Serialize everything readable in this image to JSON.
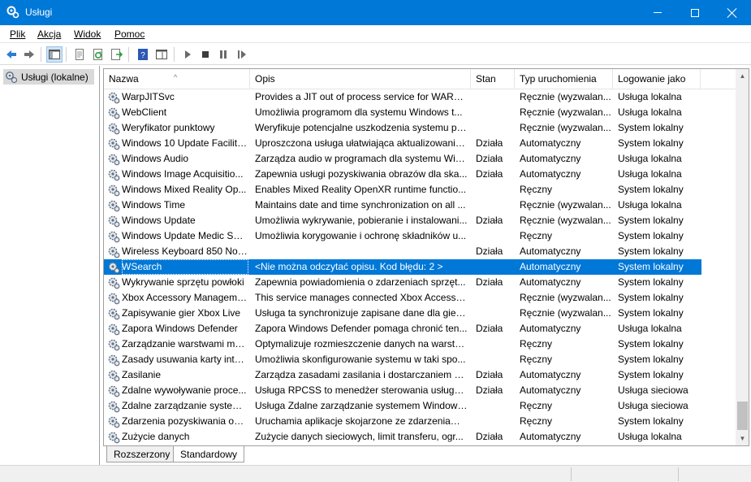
{
  "window": {
    "title": "Usługi"
  },
  "menu": [
    "Plik",
    "Akcja",
    "Widok",
    "Pomoc"
  ],
  "tree": {
    "root_label": "Usługi (lokalne)"
  },
  "columns": [
    "Nazwa",
    "Opis",
    "Stan",
    "Typ uruchomienia",
    "Logowanie jako"
  ],
  "rows": [
    [
      "WarpJITSvc",
      "Provides a JIT out of process service for WARP ...",
      "",
      "Ręcznie (wyzwalan...",
      "Usługa lokalna"
    ],
    [
      "WebClient",
      "Umożliwia programom dla systemu Windows t...",
      "",
      "Ręcznie (wyzwalan...",
      "Usługa lokalna"
    ],
    [
      "Weryfikator punktowy",
      "Weryfikuje potencjalne uszkodzenia systemu pli...",
      "",
      "Ręcznie (wyzwalan...",
      "System lokalny"
    ],
    [
      "Windows 10 Update Facilita...",
      "Uproszczona usługa ułatwiająca aktualizowanie ...",
      "Działa",
      "Automatyczny",
      "System lokalny"
    ],
    [
      "Windows Audio",
      "Zarządza audio w programach dla systemu Win...",
      "Działa",
      "Automatyczny",
      "Usługa lokalna"
    ],
    [
      "Windows Image Acquisitio...",
      "Zapewnia usługi pozyskiwania obrazów dla ska...",
      "Działa",
      "Automatyczny",
      "Usługa lokalna"
    ],
    [
      "Windows Mixed Reality Op...",
      "Enables Mixed Reality OpenXR runtime functio...",
      "",
      "Ręczny",
      "System lokalny"
    ],
    [
      "Windows Time",
      "Maintains date and time synchronization on all ...",
      "",
      "Ręcznie (wyzwalan...",
      "Usługa lokalna"
    ],
    [
      "Windows Update",
      "Umożliwia wykrywanie, pobieranie i instalowani...",
      "Działa",
      "Ręcznie (wyzwalan...",
      "System lokalny"
    ],
    [
      "Windows Update Medic Ser...",
      "Umożliwia korygowanie i ochronę składników u...",
      "",
      "Ręczny",
      "System lokalny"
    ],
    [
      "Wireless Keyboard 850 Notif...",
      "",
      "Działa",
      "Automatyczny",
      "System lokalny"
    ],
    [
      "WSearch",
      "<Nie można odczytać opisu. Kod błędu: 2 >",
      "",
      "Automatyczny",
      "System lokalny"
    ],
    [
      "Wykrywanie sprzętu powłoki",
      "Zapewnia powiadomienia o zdarzeniach sprzęt...",
      "Działa",
      "Automatyczny",
      "System lokalny"
    ],
    [
      "Xbox Accessory Manageme...",
      "This service manages connected Xbox Accessor...",
      "",
      "Ręcznie (wyzwalan...",
      "System lokalny"
    ],
    [
      "Zapisywanie gier Xbox Live",
      "Usługa ta synchronizuje zapisane dane dla gier ...",
      "",
      "Ręcznie (wyzwalan...",
      "System lokalny"
    ],
    [
      "Zapora Windows Defender",
      "Zapora Windows Defender pomaga chronić ten...",
      "Działa",
      "Automatyczny",
      "Usługa lokalna"
    ],
    [
      "Zarządzanie warstwami ma...",
      "Optymalizuje rozmieszczenie danych na warstw...",
      "",
      "Ręczny",
      "System lokalny"
    ],
    [
      "Zasady usuwania karty intel...",
      "Umożliwia skonfigurowanie systemu w taki spo...",
      "",
      "Ręczny",
      "System lokalny"
    ],
    [
      "Zasilanie",
      "Zarządza zasadami zasilania i dostarczaniem po...",
      "Działa",
      "Automatyczny",
      "System lokalny"
    ],
    [
      "Zdalne wywoływanie proce...",
      "Usługa RPCSS to menedżer sterowania usługam...",
      "Działa",
      "Automatyczny",
      "Usługa sieciowa"
    ],
    [
      "Zdalne zarządzanie systeme...",
      "Usługa Zdalne zarządzanie systemem Windows ...",
      "",
      "Ręczny",
      "Usługa sieciowa"
    ],
    [
      "Zdarzenia pozyskiwania obr...",
      "Uruchamia aplikacje skojarzone ze zdarzeniami ...",
      "",
      "Ręczny",
      "System lokalny"
    ],
    [
      "Zużycie danych",
      "Zużycie danych sieciowych, limit transferu, ogr...",
      "Działa",
      "Automatyczny",
      "Usługa lokalna"
    ]
  ],
  "selected_row": "WSearch",
  "tabs": [
    "Rozszerzony",
    "Standardowy"
  ],
  "active_tab": "Standardowy",
  "colors": {
    "titlebar": "#0078d7",
    "selection": "#0078d7"
  }
}
